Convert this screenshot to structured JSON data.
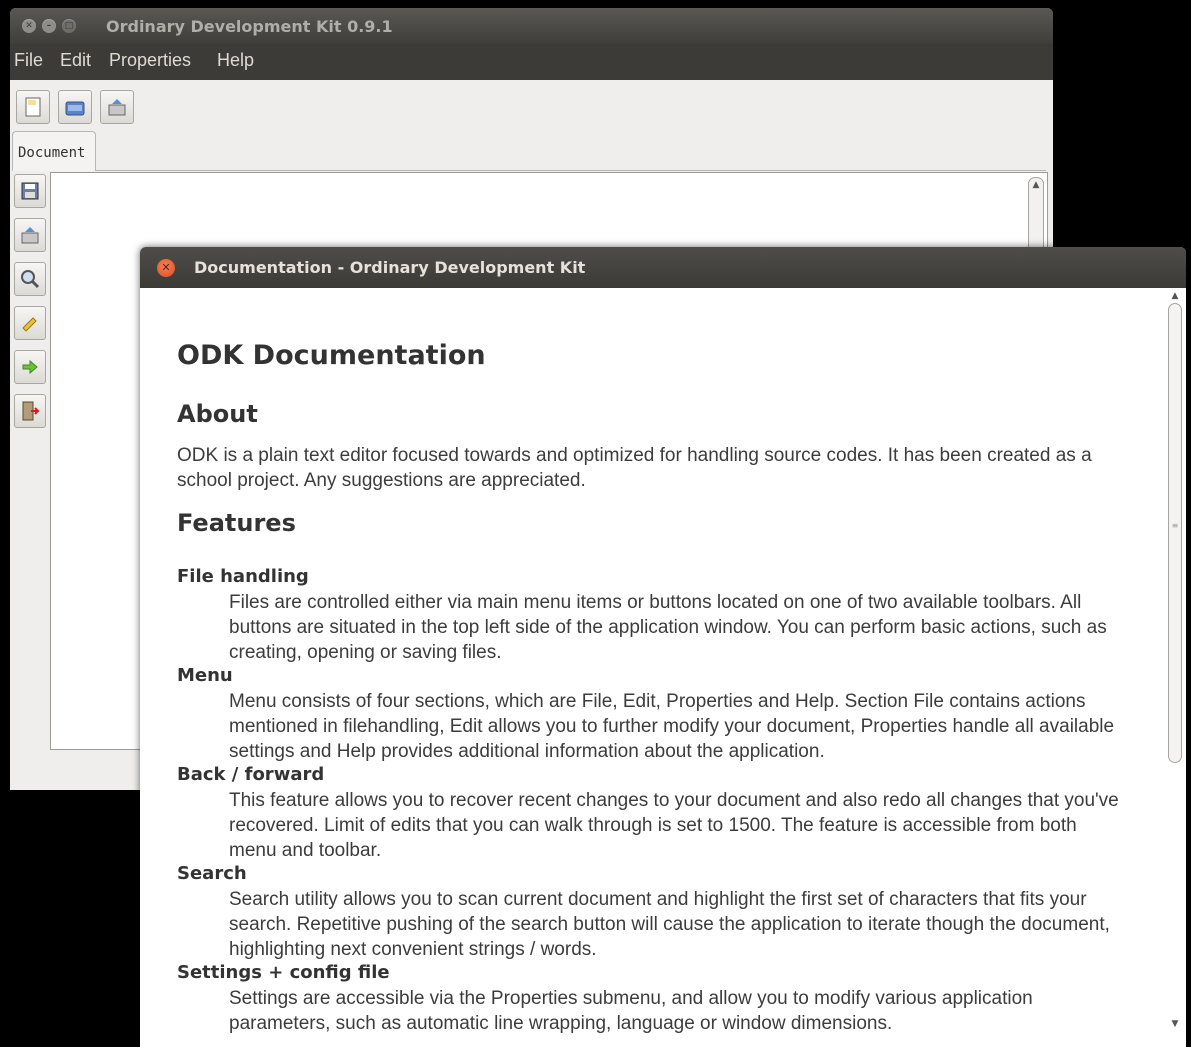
{
  "main_window": {
    "title": "Ordinary Development Kit 0.9.1",
    "menu": [
      "File",
      "Edit",
      "Properties",
      "Help"
    ],
    "toolbar_icons": [
      "new-file-icon",
      "open-file-icon",
      "save-as-icon"
    ],
    "tab_label": "Document",
    "side_icons": [
      "save-icon",
      "save-as-icon",
      "search-icon",
      "pencil-icon",
      "redo-icon",
      "exit-icon"
    ]
  },
  "doc_window": {
    "title": "Documentation - Ordinary Development Kit",
    "heading": "ODK Documentation",
    "about": {
      "heading": "About",
      "text": "ODK is a plain text editor focused towards and optimized for handling source codes. It has been created as a school project. Any suggestions are appreciated."
    },
    "features": {
      "heading": "Features",
      "items": [
        {
          "term": "File handling",
          "desc": "Files are controlled either via main menu items or buttons located on one of two available toolbars. All buttons are situated in the top left side of the application window. You can perform basic actions, such as creating, opening or saving files."
        },
        {
          "term": "Menu",
          "desc": "Menu consists of four sections, which are File, Edit, Properties and Help. Section File contains actions mentioned in filehandling, Edit allows you to further modify your document, Properties handle all available settings and Help provides additional information about the application."
        },
        {
          "term": "Back / forward",
          "desc": "This feature allows you to recover recent changes to your document and also redo all changes that you've recovered. Limit of edits that you can walk through is set to 1500. The feature is accessible from both menu and toolbar."
        },
        {
          "term": "Search",
          "desc": "Search utility allows you to scan current document and highlight the first set of characters that fits your search. Repetitive pushing of the search button will cause the application to iterate though the document, highlighting next convenient strings / words."
        },
        {
          "term": "Settings + config file",
          "desc": "Settings are accessible via the Properties submenu, and allow you to modify various application parameters, such as automatic line wrapping, language or window dimensions."
        }
      ]
    }
  }
}
